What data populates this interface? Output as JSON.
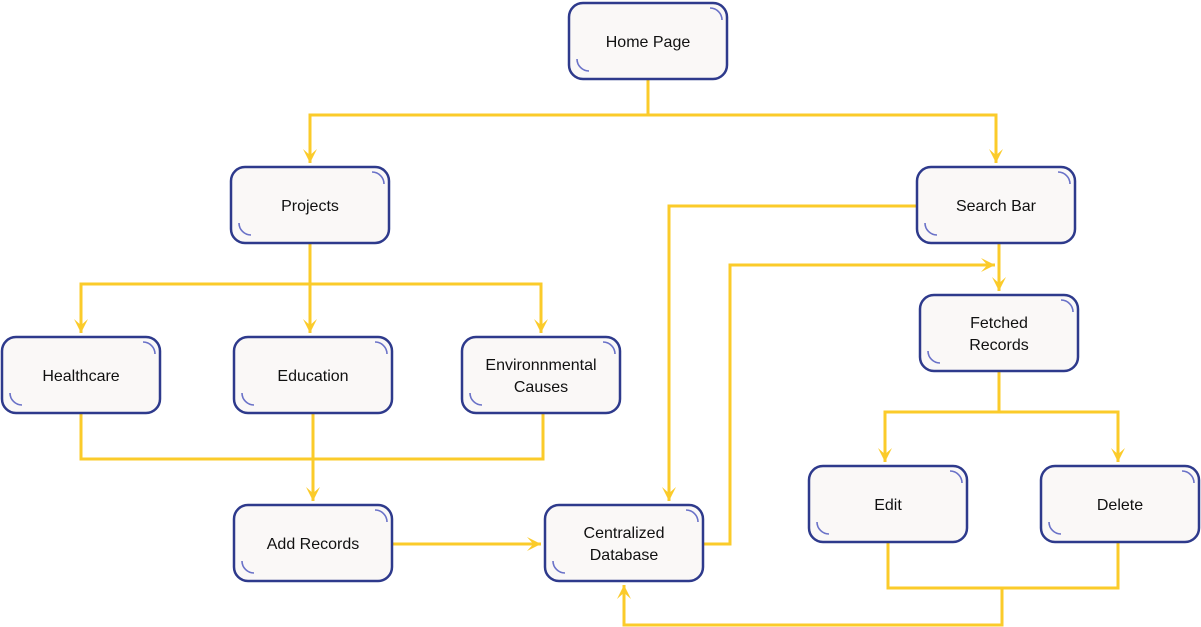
{
  "diagram": {
    "type": "flowchart",
    "colors": {
      "node_fill": "#faf8f7",
      "node_border": "#2e3a8c",
      "corner_accent": "#6a72c8",
      "connector": "#fbcb2a",
      "text": "#111111"
    },
    "nodes": [
      {
        "id": "home",
        "label_lines": [
          "Home Page"
        ]
      },
      {
        "id": "projects",
        "label_lines": [
          "Projects"
        ]
      },
      {
        "id": "search",
        "label_lines": [
          "Search Bar"
        ]
      },
      {
        "id": "healthcare",
        "label_lines": [
          "Healthcare"
        ]
      },
      {
        "id": "education",
        "label_lines": [
          "Education"
        ]
      },
      {
        "id": "environmental",
        "label_lines": [
          "Environnmental",
          "Causes"
        ]
      },
      {
        "id": "fetched",
        "label_lines": [
          "Fetched",
          "Records"
        ]
      },
      {
        "id": "add",
        "label_lines": [
          "Add Records"
        ]
      },
      {
        "id": "database",
        "label_lines": [
          "Centralized",
          "Database"
        ]
      },
      {
        "id": "edit",
        "label_lines": [
          "Edit"
        ]
      },
      {
        "id": "delete",
        "label_lines": [
          "Delete"
        ]
      }
    ],
    "edges": [
      {
        "from": "home",
        "to": "projects"
      },
      {
        "from": "home",
        "to": "search"
      },
      {
        "from": "projects",
        "to": "healthcare"
      },
      {
        "from": "projects",
        "to": "education"
      },
      {
        "from": "projects",
        "to": "environmental"
      },
      {
        "from": "healthcare",
        "to": "add"
      },
      {
        "from": "education",
        "to": "add"
      },
      {
        "from": "environmental",
        "to": "add"
      },
      {
        "from": "add",
        "to": "database"
      },
      {
        "from": "search",
        "to": "database"
      },
      {
        "from": "search",
        "to": "fetched"
      },
      {
        "from": "database",
        "to": "fetched"
      },
      {
        "from": "fetched",
        "to": "edit"
      },
      {
        "from": "fetched",
        "to": "delete"
      },
      {
        "from": "edit",
        "to": "database"
      },
      {
        "from": "delete",
        "to": "database"
      }
    ]
  }
}
